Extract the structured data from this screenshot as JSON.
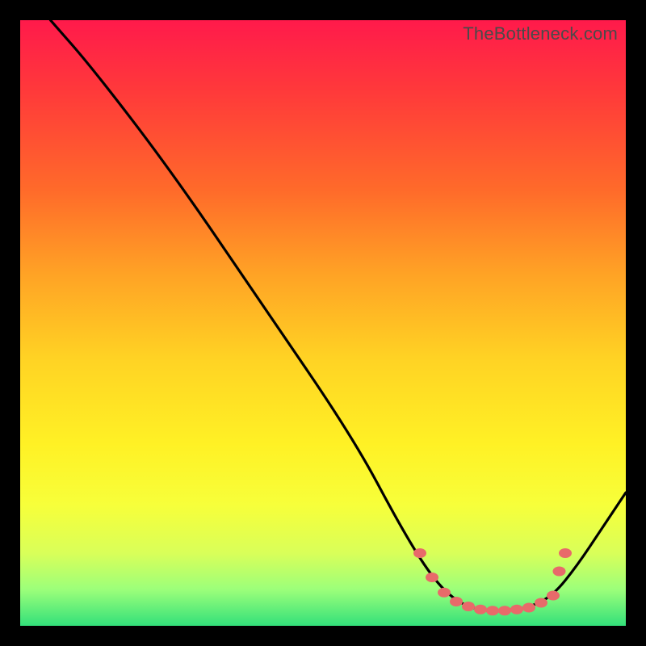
{
  "watermark": "TheBottleneck.com",
  "chart_data": {
    "type": "line",
    "title": "",
    "xlabel": "",
    "ylabel": "",
    "xlim": [
      0,
      100
    ],
    "ylim": [
      0,
      100
    ],
    "series": [
      {
        "name": "curve",
        "color": "#000000",
        "points": [
          {
            "x": 5,
            "y": 100
          },
          {
            "x": 12,
            "y": 92
          },
          {
            "x": 25,
            "y": 75
          },
          {
            "x": 40,
            "y": 53
          },
          {
            "x": 55,
            "y": 31
          },
          {
            "x": 63,
            "y": 16
          },
          {
            "x": 68,
            "y": 8
          },
          {
            "x": 72,
            "y": 4
          },
          {
            "x": 76,
            "y": 2.5
          },
          {
            "x": 80,
            "y": 2.5
          },
          {
            "x": 84,
            "y": 3
          },
          {
            "x": 88,
            "y": 5
          },
          {
            "x": 92,
            "y": 10
          },
          {
            "x": 96,
            "y": 16
          },
          {
            "x": 100,
            "y": 22
          }
        ]
      }
    ],
    "markers": {
      "name": "highlight-dots",
      "color": "#e86a6a",
      "points": [
        {
          "x": 66,
          "y": 12
        },
        {
          "x": 68,
          "y": 8
        },
        {
          "x": 70,
          "y": 5.5
        },
        {
          "x": 72,
          "y": 4
        },
        {
          "x": 74,
          "y": 3.2
        },
        {
          "x": 76,
          "y": 2.7
        },
        {
          "x": 78,
          "y": 2.5
        },
        {
          "x": 80,
          "y": 2.5
        },
        {
          "x": 82,
          "y": 2.7
        },
        {
          "x": 84,
          "y": 3
        },
        {
          "x": 86,
          "y": 3.8
        },
        {
          "x": 88,
          "y": 5
        },
        {
          "x": 89,
          "y": 9
        },
        {
          "x": 90,
          "y": 12
        }
      ]
    }
  }
}
